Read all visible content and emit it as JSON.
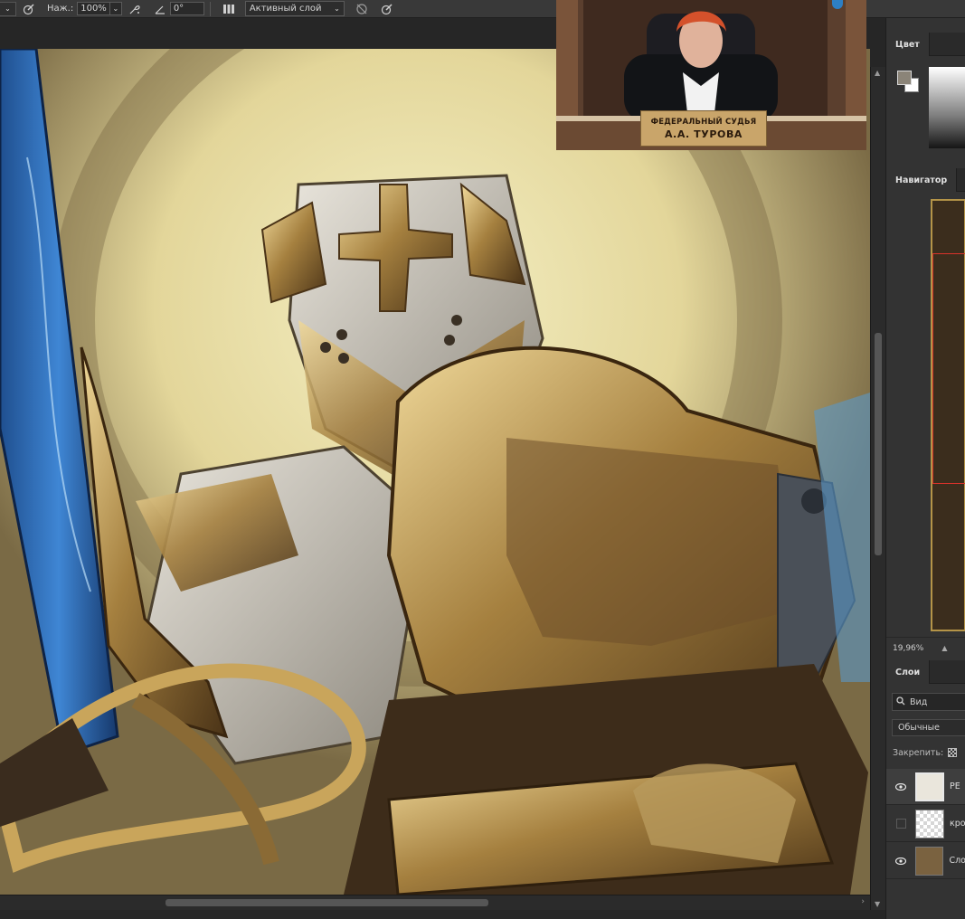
{
  "options_bar": {
    "pressure_label": "Наж.:",
    "pressure_value": "100%",
    "angle_value": "0°",
    "sample_mode": "Активный слой"
  },
  "video_overlay": {
    "plaque_line1": "ФЕДЕРАЛЬНЫЙ СУДЬЯ",
    "plaque_line2": "А.А. ТУРОВА"
  },
  "panels": {
    "color_tab": "Цвет",
    "navigator_tab": "Навигатор",
    "zoom": "19,96%",
    "layers_tab": "Слои",
    "filter_placeholder": "Вид",
    "blend_mode": "Обычные",
    "lock_label": "Закрепить:",
    "layers": [
      {
        "name": "РЕ"
      },
      {
        "name": "кро"
      },
      {
        "name": "Сло"
      }
    ]
  },
  "colors": {
    "foreground": "#8b8478",
    "background": "#ffffff",
    "selection_frame": "#d8322a"
  }
}
